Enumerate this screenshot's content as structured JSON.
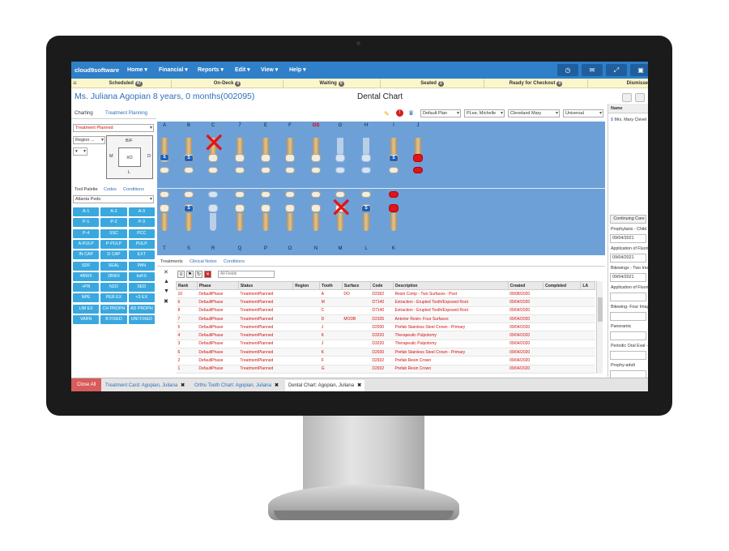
{
  "app": {
    "brand": "cloud9software",
    "menus": [
      "Home ▾",
      "Financial ▾",
      "Reports ▾",
      "Edit ▾",
      "View ▾",
      "Help ▾"
    ]
  },
  "status": [
    {
      "label": "Scheduled",
      "count": "47"
    },
    {
      "label": "On-Deck",
      "count": "0"
    },
    {
      "label": "Waiting",
      "count": "0"
    },
    {
      "label": "Seated",
      "count": "2"
    },
    {
      "label": "Ready for Checkout",
      "count": "0"
    },
    {
      "label": "Dismisse",
      "count": ""
    }
  ],
  "patient": {
    "title": "Ms. Juliana Agopian 8 years, 0 months(002095)",
    "chart_title": "Dental Chart"
  },
  "toolbar": {
    "plan": "Default Plan",
    "provider": "PLee, Michelle",
    "doctor": "Cleveland Mary",
    "view": "Universal"
  },
  "left": {
    "tabs": [
      "Charting",
      "Treatment Planning"
    ],
    "status_select": "Treatment Planned",
    "region_select": "Region ...",
    "surfaces": {
      "bf": "B/F",
      "m": "M",
      "d": "D",
      "l": "L",
      "io": "I/O"
    },
    "palette_tabs": [
      "Tool Palette",
      "Codes",
      "Conditions"
    ],
    "palette_select": "Atlanta Pedo",
    "palette": [
      [
        "A-1",
        "A-2",
        "A-3"
      ],
      [
        "P-1",
        "P-2",
        "P-3"
      ],
      [
        "P-4",
        "SSC",
        "PCC"
      ],
      [
        "A-PULP",
        "P-PULP",
        "PULP"
      ],
      [
        "IN CAP",
        "D CAP",
        "EXT"
      ],
      [
        "SDF",
        "SEAL",
        "PAN"
      ],
      [
        "4BWX",
        "2BWX",
        "bxFX"
      ],
      [
        "+PR",
        "N2O",
        "SED"
      ],
      [
        "NPE",
        "PER EX",
        "<3 EX"
      ],
      [
        "LIM EX",
        "CH PROPH",
        "AD PROPH"
      ],
      [
        "VARN",
        "B FIXED",
        "UNI FIXED"
      ]
    ]
  },
  "chart": {
    "upper_labels": [
      "A",
      "B",
      "C",
      "7",
      "E",
      "F",
      "GS",
      "G",
      "H",
      "I",
      "J"
    ],
    "lower_labels": [
      "T",
      "S",
      "R",
      "Q",
      "P",
      "O",
      "N",
      "M",
      "L",
      "K"
    ]
  },
  "bottom_tabs": [
    "Treatments",
    "Clinical Notes",
    "Conditions"
  ],
  "filter_placeholder": "All Fields",
  "grid": {
    "headers": [
      "Rank",
      "Phase",
      "Status",
      "Region",
      "Tooth",
      "Surface",
      "Code",
      "Description",
      "Created",
      "Completed",
      "LA"
    ],
    "rows": [
      [
        "10",
        "DefaultPhase",
        "TreatmentPlanned",
        "",
        "A",
        "DO",
        "D2392",
        "Resin Comp - Two Surfaces - Post",
        "09/08/2020",
        "",
        ""
      ],
      [
        "6",
        "DefaultPhase",
        "TreatmentPlanned",
        "",
        "M",
        "",
        "D7140",
        "Extraction - Erupted Tooth/Exposed Root",
        "09/04/2020",
        "",
        ""
      ],
      [
        "8",
        "DefaultPhase",
        "TreatmentPlanned",
        "",
        "C",
        "",
        "D7140",
        "Extraction - Erupted Tooth/Exposed Root",
        "09/04/2020",
        "",
        ""
      ],
      [
        "7",
        "DefaultPhase",
        "TreatmentPlanned",
        "",
        "D",
        "MODB",
        "D2335",
        "Anterior Resin- Four Surfaces",
        "09/04/2020",
        "",
        ""
      ],
      [
        "5",
        "DefaultPhase",
        "TreatmentPlanned",
        "",
        "J",
        "",
        "D2930",
        "Prefab Stainless Steel Crown - Primary",
        "09/04/2020",
        "",
        ""
      ],
      [
        "4",
        "DefaultPhase",
        "TreatmentPlanned",
        "",
        "K",
        "",
        "D3220",
        "Therapeutic Pulpotomy",
        "09/04/2020",
        "",
        ""
      ],
      [
        "3",
        "DefaultPhase",
        "TreatmentPlanned",
        "",
        "J",
        "",
        "D3220",
        "Therapeutic Pulpotomy",
        "09/04/2020",
        "",
        ""
      ],
      [
        "6",
        "DefaultPhase",
        "TreatmentPlanned",
        "",
        "K",
        "",
        "D2930",
        "Prefab Stainless Steel Crown - Primary",
        "09/04/2020",
        "",
        ""
      ],
      [
        "2",
        "DefaultPhase",
        "TreatmentPlanned",
        "",
        "F",
        "",
        "D2932",
        "Prefab Resin Crown",
        "09/04/2020",
        "",
        ""
      ],
      [
        "1",
        "DefaultPhase",
        "TreatmentPlanned",
        "",
        "G",
        "",
        "D2932",
        "Prefab Resin Crown",
        "09/04/2020",
        "",
        ""
      ]
    ]
  },
  "right": {
    "header": "Name",
    "name": "Mrs. Mary Clevel",
    "continuing": "Continuing Care",
    "items": [
      {
        "label": "Prophylaxis - Child",
        "value": "09/04/2021"
      },
      {
        "label": "Application of Fluori",
        "value": "09/04/2021"
      },
      {
        "label": "Bitewings - Two Ima",
        "value": "09/04/2021"
      },
      {
        "label": "Application of Fluori",
        "value": ""
      },
      {
        "label": "Bitewing- Four Imag",
        "value": ""
      },
      {
        "label": "Panoramic",
        "value": ""
      },
      {
        "label": "Periodic Oral Eval -",
        "value": ""
      },
      {
        "label": "Prophy-adult",
        "value": ""
      }
    ]
  },
  "footer": {
    "close_all": "Close All",
    "tabs": [
      "Treatment Card: Agopian, Juliana",
      "Ortho Tooth Chart: Agopian, Juliana",
      "Dental Chart: Agopian, Juliana"
    ]
  },
  "colors": {
    "nav": "#2f7fc9",
    "chart_bg": "#6ea0d8",
    "palette": "#3aa8de",
    "status_bar": "#fbf6cc",
    "planned_text": "#d31010"
  }
}
